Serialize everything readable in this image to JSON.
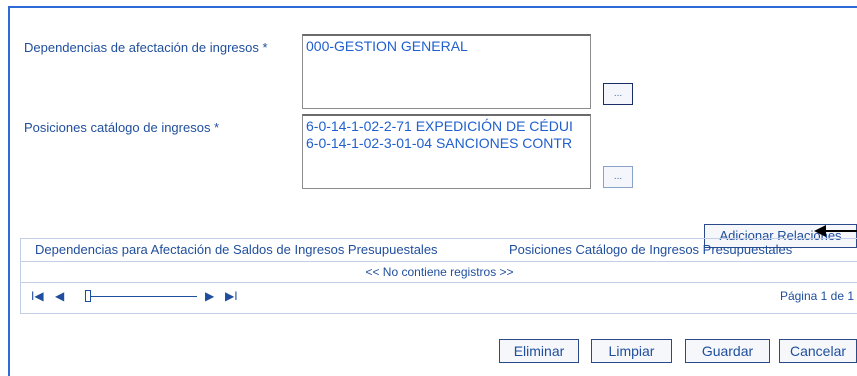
{
  "form": {
    "dependencias_label": "Dependencias de afectación de ingresos *",
    "dependencias_items": [
      "000-GESTION GENERAL"
    ],
    "posiciones_label": "Posiciones catálogo de ingresos *",
    "posiciones_items": [
      "6-0-14-1-02-2-71 EXPEDICIÓN DE CÉDUI",
      "6-0-14-1-02-3-01-04 SANCIONES CONTR"
    ],
    "dots_label": "...",
    "adicionar_label": "Adicionar Relaciones"
  },
  "grid": {
    "col1": "Dependencias para Afectación de Saldos de Ingresos Presupuestales",
    "col2": "Posiciones Catálogo de Ingresos Presupuestales",
    "empty": "<< No contiene registros >>",
    "page_info": "Página 1 de 1",
    "nav_first": "I◀",
    "nav_prev": "◀",
    "nav_next": "▶",
    "nav_last": "▶I"
  },
  "actions": {
    "eliminar": "Eliminar",
    "limpiar": "Limpiar",
    "guardar": "Guardar",
    "cancelar": "Cancelar"
  }
}
